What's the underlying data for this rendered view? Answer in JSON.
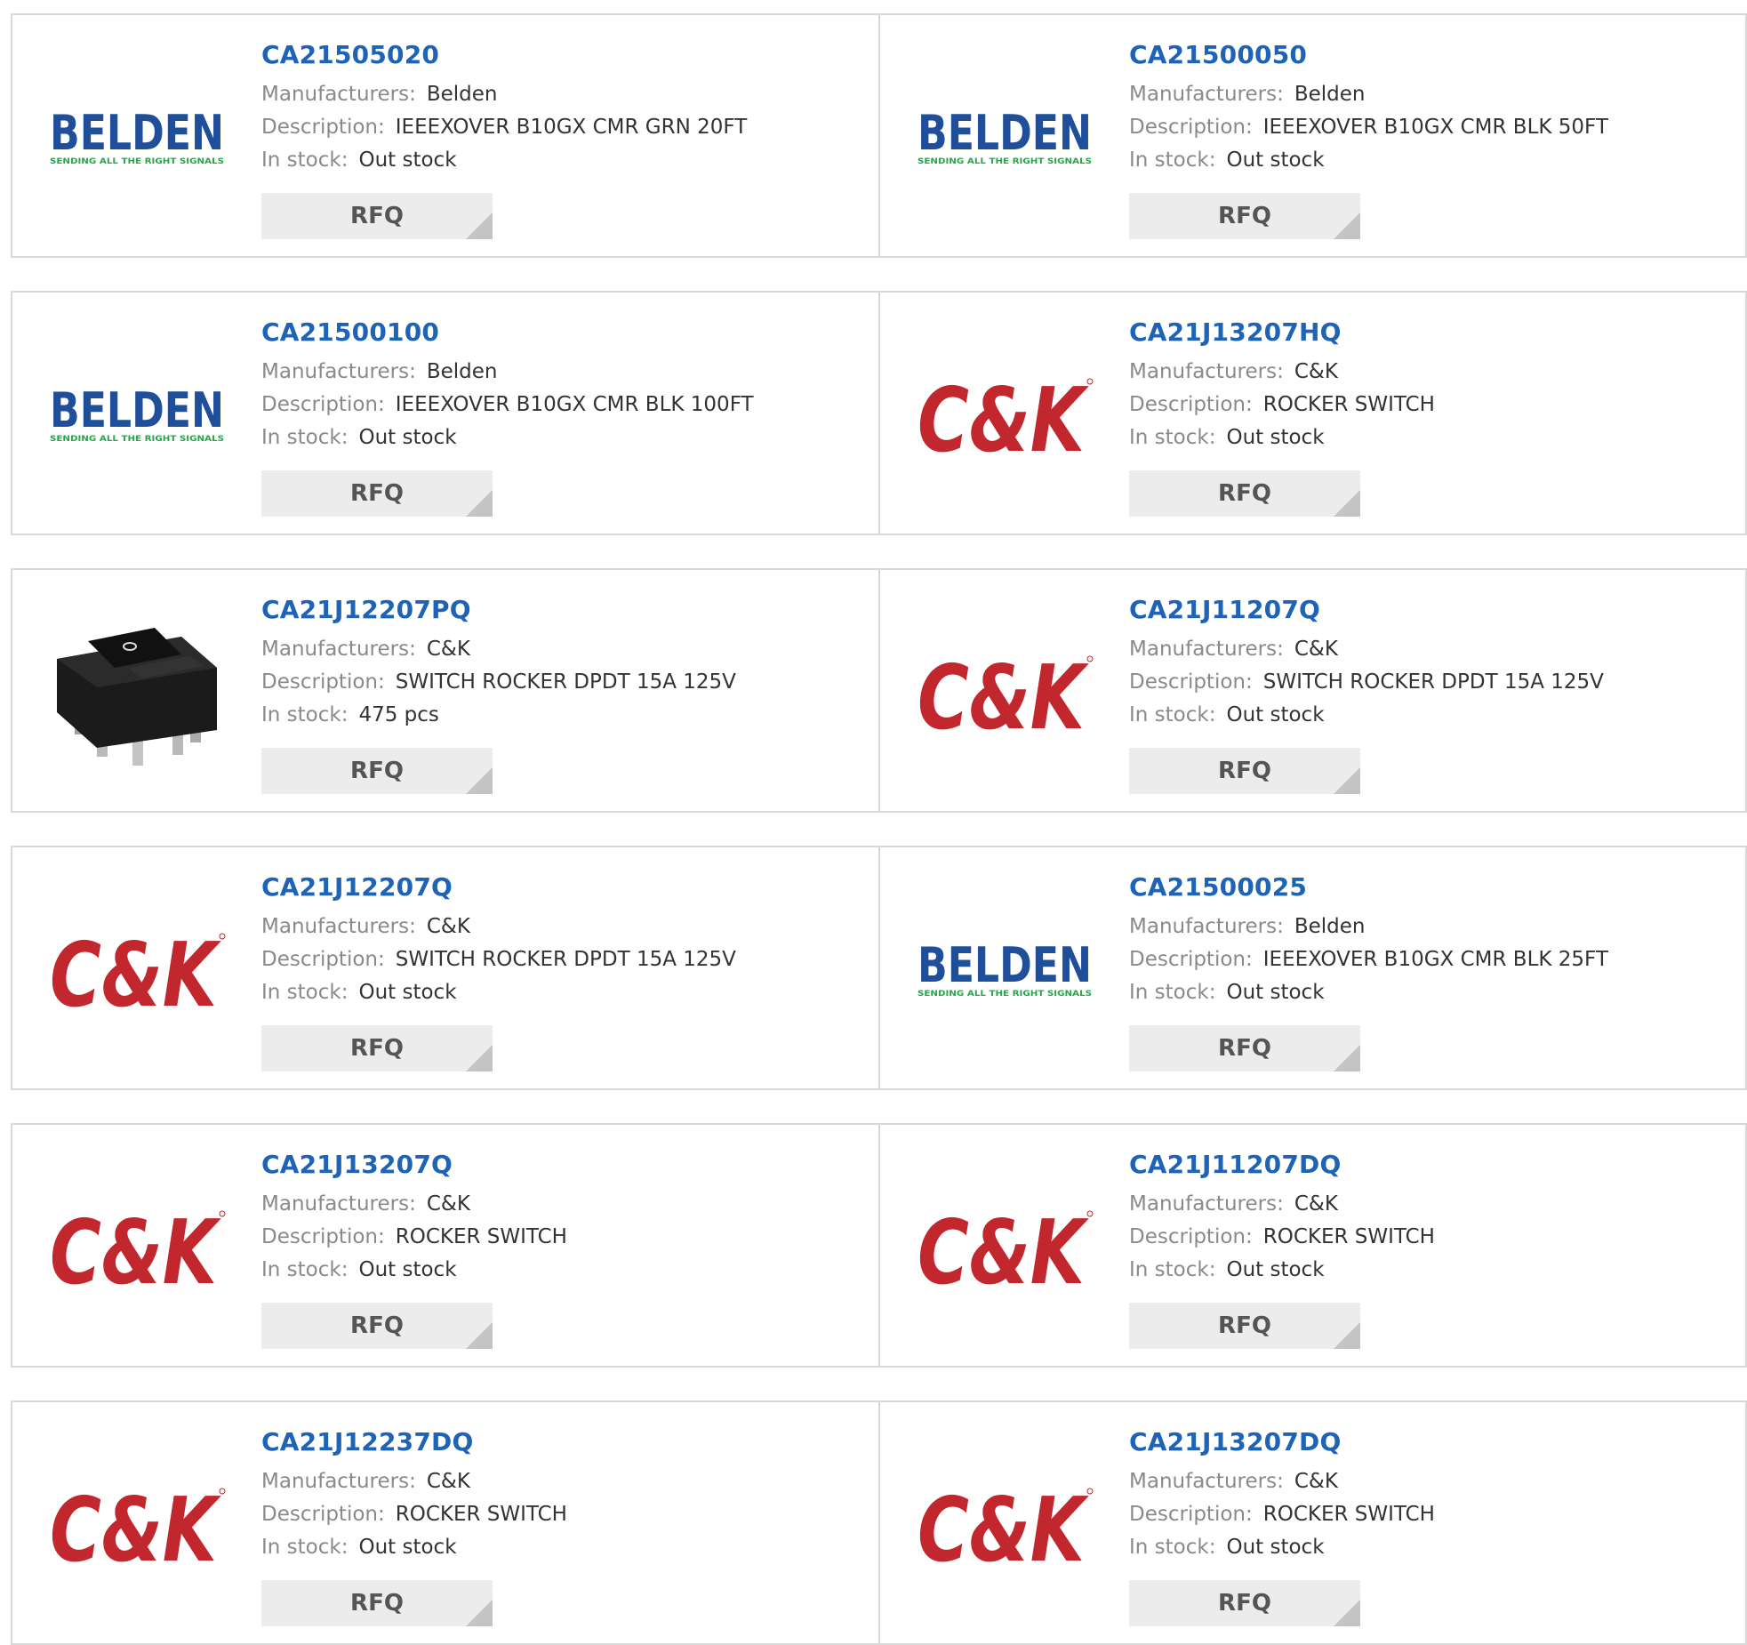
{
  "labels": {
    "manufacturers": "Manufacturers:",
    "description": "Description:",
    "in_stock": "In stock:",
    "rfq": "RFQ"
  },
  "brand_logos": {
    "belden": {
      "name": "BELDEN",
      "tagline": "SENDING ALL THE RIGHT SIGNALS",
      "color": "#1f4e9a",
      "tagline_color": "#2aa34a"
    },
    "ck": {
      "name": "C&K",
      "color": "#c1272d"
    }
  },
  "products": [
    {
      "part_number": "CA21505020",
      "manufacturer": "Belden",
      "description": "IEEEXOVER B10GX CMR GRN 20FT",
      "stock": "Out stock",
      "logo": "belden"
    },
    {
      "part_number": "CA21500050",
      "manufacturer": "Belden",
      "description": "IEEEXOVER B10GX CMR BLK 50FT",
      "stock": "Out stock",
      "logo": "belden"
    },
    {
      "part_number": "CA21500100",
      "manufacturer": "Belden",
      "description": "IEEEXOVER B10GX CMR BLK 100FT",
      "stock": "Out stock",
      "logo": "belden"
    },
    {
      "part_number": "CA21J13207HQ",
      "manufacturer": "C&K",
      "description": "ROCKER SWITCH",
      "stock": "Out stock",
      "logo": "ck"
    },
    {
      "part_number": "CA21J12207PQ",
      "manufacturer": "C&K",
      "description": "SWITCH ROCKER DPDT 15A 125V",
      "stock": "475 pcs",
      "logo": "rocker-switch-photo"
    },
    {
      "part_number": "CA21J11207Q",
      "manufacturer": "C&K",
      "description": "SWITCH ROCKER DPDT 15A 125V",
      "stock": "Out stock",
      "logo": "ck"
    },
    {
      "part_number": "CA21J12207Q",
      "manufacturer": "C&K",
      "description": "SWITCH ROCKER DPDT 15A 125V",
      "stock": "Out stock",
      "logo": "ck"
    },
    {
      "part_number": "CA21500025",
      "manufacturer": "Belden",
      "description": "IEEEXOVER B10GX CMR BLK 25FT",
      "stock": "Out stock",
      "logo": "belden"
    },
    {
      "part_number": "CA21J13207Q",
      "manufacturer": "C&K",
      "description": "ROCKER SWITCH",
      "stock": "Out stock",
      "logo": "ck"
    },
    {
      "part_number": "CA21J11207DQ",
      "manufacturer": "C&K",
      "description": "ROCKER SWITCH",
      "stock": "Out stock",
      "logo": "ck"
    },
    {
      "part_number": "CA21J12237DQ",
      "manufacturer": "C&K",
      "description": "ROCKER SWITCH",
      "stock": "Out stock",
      "logo": "ck"
    },
    {
      "part_number": "CA21J13207DQ",
      "manufacturer": "C&K",
      "description": "ROCKER SWITCH",
      "stock": "Out stock",
      "logo": "ck"
    }
  ]
}
